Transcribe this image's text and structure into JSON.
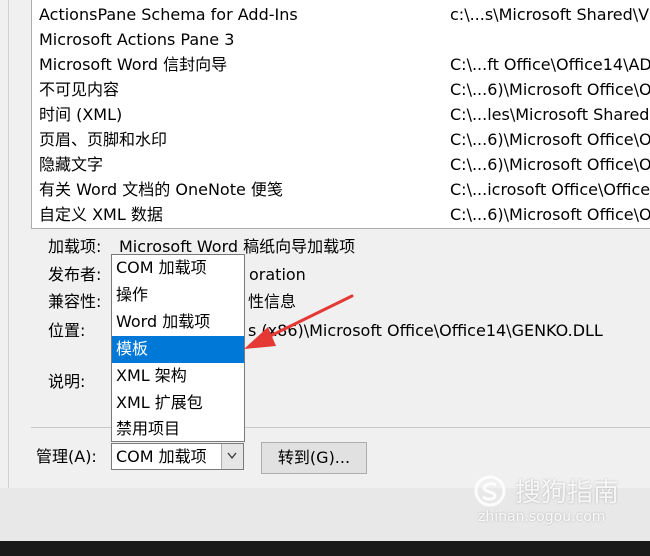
{
  "addins_list": [
    {
      "name": "ActionsPane Schema for Add-Ins",
      "location": "c:\\...s\\Microsoft Shared\\V"
    },
    {
      "name": "Microsoft Actions Pane 3",
      "location": ""
    },
    {
      "name": "Microsoft Word 信封向导",
      "location": "C:\\...ft Office\\Office14\\AD"
    },
    {
      "name": "不可见内容",
      "location": "C:\\...6)\\Microsoft Office\\O"
    },
    {
      "name": "时间 (XML)",
      "location": "C:\\...les\\Microsoft Shared"
    },
    {
      "name": "页眉、页脚和水印",
      "location": "C:\\...6)\\Microsoft Office\\O"
    },
    {
      "name": "隐藏文字",
      "location": "C:\\...6)\\Microsoft Office\\O"
    },
    {
      "name": "有关 Word 文档的 OneNote 便笺",
      "location": "C:\\...icrosoft Office\\Office"
    },
    {
      "name": "自定义 XML 数据",
      "location": "C:\\...6)\\Microsoft Office\\O"
    }
  ],
  "details": {
    "addin_label": "加载项:",
    "addin_value": "Microsoft Word 稿纸向导加载项",
    "publisher_label": "发布者:",
    "publisher_value": "oration",
    "compat_label": "兼容性:",
    "compat_value": "性信息",
    "location_label": "位置:",
    "location_value": "s (x86)\\Microsoft Office\\Office14\\GENKO.DLL",
    "desc_label": "说明:"
  },
  "manage": {
    "label": "管理(A):",
    "selected_value": "COM 加载项",
    "goto_button": "转到(G)..."
  },
  "dropdown": {
    "options": [
      "COM 加载项",
      "操作",
      "Word 加载项",
      "模板",
      "XML 架构",
      "XML 扩展包",
      "禁用项目"
    ],
    "highlighted_index": 3
  },
  "annotation": {
    "color": "#e53935"
  },
  "watermark": {
    "text": "搜狗指南",
    "url": "zhinan.sogou.com"
  },
  "colors": {
    "selection": "#0078d7",
    "panel_bg": "#f0f0f0",
    "list_bg": "#ffffff"
  }
}
